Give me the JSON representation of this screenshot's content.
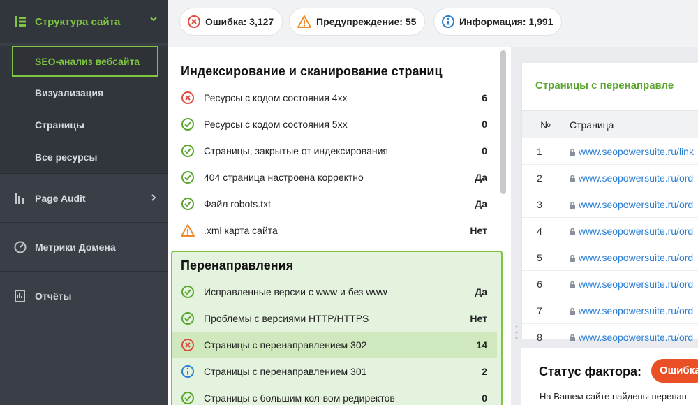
{
  "sidebar": {
    "section": "Структура сайта",
    "sub_items": [
      "SEO-анализ вебсайта",
      "Визуализация",
      "Страницы",
      "Все ресурсы"
    ],
    "nav": [
      "Page Audit",
      "Метрики Домена",
      "Отчёты"
    ]
  },
  "summary": {
    "error": "Ошибка: 3,127",
    "warning": "Предупреждение: 55",
    "info": "Информация: 1,991"
  },
  "indexing": {
    "title": "Индексирование и сканирование страниц",
    "rows": [
      {
        "text": "Ресурсы с кодом состояния 4xx",
        "value": "6",
        "status": "error"
      },
      {
        "text": "Ресурсы с кодом состояния 5xx",
        "value": "0",
        "status": "ok"
      },
      {
        "text": "Страницы, закрытые от индексирования",
        "value": "0",
        "status": "ok"
      },
      {
        "text": "404 страница настроена корректно",
        "value": "Да",
        "status": "ok"
      },
      {
        "text": "Файл robots.txt",
        "value": "Да",
        "status": "ok"
      },
      {
        "text": ".xml карта сайта",
        "value": "Нет",
        "status": "warning"
      }
    ]
  },
  "redirects": {
    "title": "Перенаправления",
    "rows": [
      {
        "text": "Исправленные версии с www и без www",
        "value": "Да",
        "status": "ok"
      },
      {
        "text": "Проблемы с версиями HTTP/HTTPS",
        "value": "Нет",
        "status": "ok"
      },
      {
        "text": "Страницы с перенаправлением 302",
        "value": "14",
        "status": "error"
      },
      {
        "text": "Страницы с перенаправлением 301",
        "value": "2",
        "status": "info"
      },
      {
        "text": "Страницы с большим кол-вом редиректов",
        "value": "0",
        "status": "ok"
      }
    ]
  },
  "details": {
    "title": "Страницы с перенаправле",
    "col_num": "№",
    "col_page": "Страница",
    "rows": [
      {
        "n": "1",
        "url": "www.seopowersuite.ru/link"
      },
      {
        "n": "2",
        "url": "www.seopowersuite.ru/ord"
      },
      {
        "n": "3",
        "url": "www.seopowersuite.ru/ord"
      },
      {
        "n": "4",
        "url": "www.seopowersuite.ru/ord"
      },
      {
        "n": "5",
        "url": "www.seopowersuite.ru/ord"
      },
      {
        "n": "6",
        "url": "www.seopowersuite.ru/ord"
      },
      {
        "n": "7",
        "url": "www.seopowersuite.ru/ord"
      },
      {
        "n": "8",
        "url": "www.seopowersuite.ru/ord"
      }
    ]
  },
  "status": {
    "title": "Статус фактора:",
    "badge": "Ошибка",
    "text": "На Вашем сайте найдены перенап"
  },
  "colors": {
    "accent": "#7ec542",
    "error": "#e04b3f",
    "warning": "#f0892c",
    "info": "#2a7fd4",
    "ok": "#5aa52e"
  }
}
